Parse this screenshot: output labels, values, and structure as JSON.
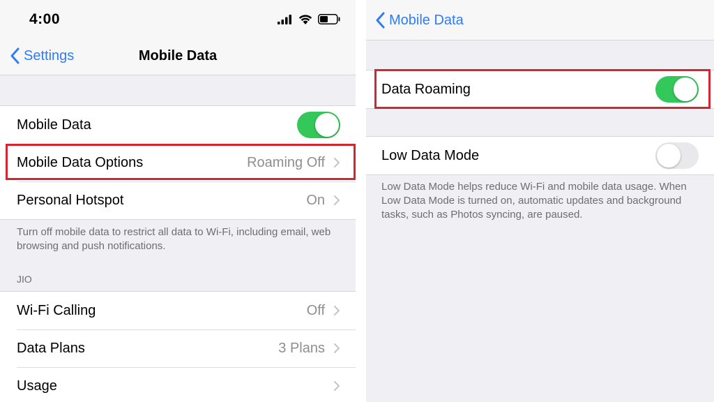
{
  "left": {
    "status_bar": {
      "time": "4:00"
    },
    "nav": {
      "back_label": "Settings",
      "title": "Mobile Data"
    },
    "rows": [
      {
        "label": "Mobile Data",
        "toggle": "on"
      },
      {
        "label": "Mobile Data Options",
        "value": "Roaming Off"
      },
      {
        "label": "Personal Hotspot",
        "value": "On"
      }
    ],
    "footer": "Turn off mobile data to restrict all data to Wi-Fi, including email, web browsing and push notifications.",
    "carrier_section": {
      "header": "JIO",
      "rows": [
        {
          "label": "Wi-Fi Calling",
          "value": "Off"
        },
        {
          "label": "Data Plans",
          "value": "3 Plans"
        },
        {
          "label": "Usage",
          "value": ""
        }
      ]
    }
  },
  "right": {
    "nav": {
      "back_label": "Mobile Data"
    },
    "rows": [
      {
        "label": "Data Roaming",
        "toggle": "on"
      },
      {
        "label": "Low Data Mode",
        "toggle": "off"
      }
    ],
    "footer": "Low Data Mode helps reduce Wi-Fi and mobile data usage. When Low Data Mode is turned on, automatic updates and background tasks, such as Photos syncing, are paused."
  },
  "colors": {
    "accent_blue": "#2f7cf6",
    "toggle_on": "#34c759",
    "toggle_off": "#e9e9eb",
    "highlight_red": "#d22630",
    "grouped_background": "#efeff4"
  },
  "icons": [
    "signal-bars-icon",
    "wifi-icon",
    "battery-icon",
    "back-chevron-icon",
    "chevron-right-icon"
  ]
}
